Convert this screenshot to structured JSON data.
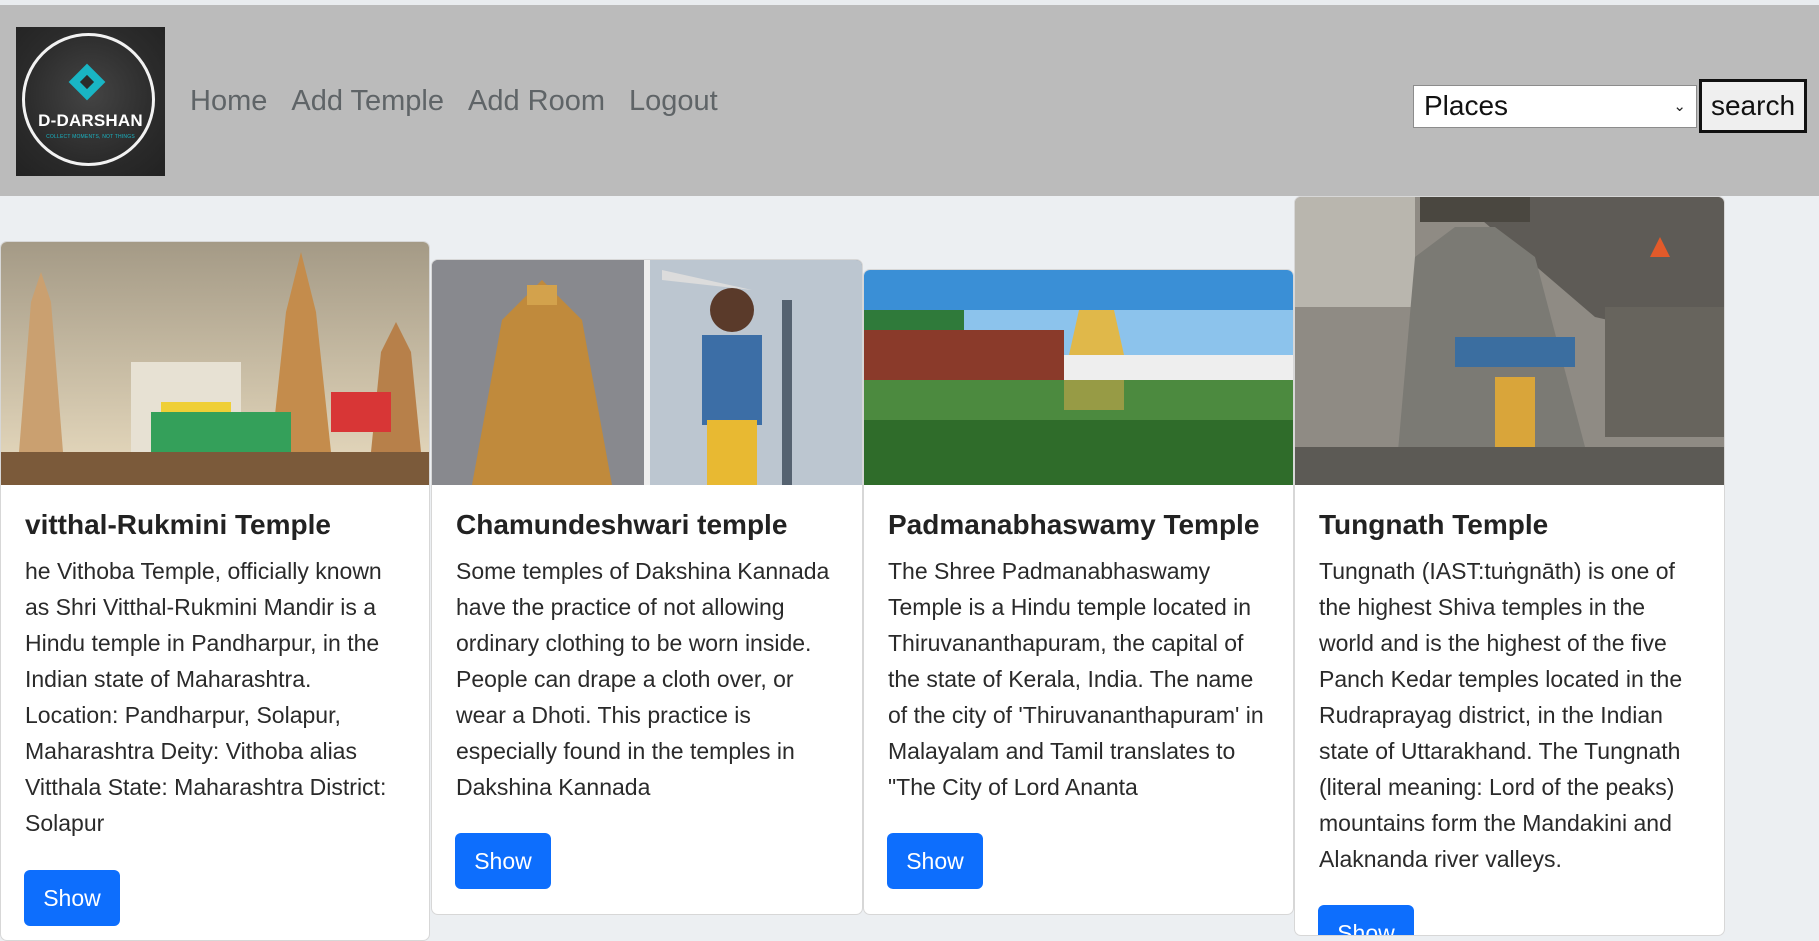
{
  "logo": {
    "title": "D-DARSHAN",
    "tagline": "COLLECT MOMENTS, NOT THINGS"
  },
  "nav": {
    "links": [
      "Home",
      "Add Temple",
      "Add Room",
      "Logout"
    ]
  },
  "search": {
    "selected": "Places",
    "button_label": "search"
  },
  "cards": [
    {
      "title": "vitthal-Rukmini Temple",
      "text": "he Vithoba Temple, officially known as Shri Vitthal-Rukmini Mandir is a Hindu temple in Pandharpur, in the Indian state of Maharashtra. Location: Pandharpur, Solapur, Maharashtra Deity: Vithoba alias Vitthala State: Maharashtra District: Solapur",
      "button": "Show",
      "image_icon": "temple-photo"
    },
    {
      "title": "Chamundeshwari temple",
      "text": "Some temples of Dakshina Kannada have the practice of not allowing ordinary clothing to be worn inside. People can drape a cloth over, or wear a Dhoti. This practice is especially found in the temples in Dakshina Kannada",
      "button": "Show",
      "image_icon": "temple-photo"
    },
    {
      "title": "Padmanabhaswamy Temple",
      "text": "The Shree Padmanabhaswamy Temple is a Hindu temple located in Thiruvananthapuram, the capital of the state of Kerala, India. The name of the city of 'Thiruvananthapuram' in Malayalam and Tamil translates to \"The City of Lord Ananta",
      "button": "Show",
      "image_icon": "temple-photo"
    },
    {
      "title": "Tungnath Temple",
      "text": "Tungnath (IAST:tuṅgnāth) is one of the highest Shiva temples in the world and is the highest of the five Panch Kedar temples located in the Rudraprayag district, in the Indian state of Uttarakhand. The Tungnath (literal meaning: Lord of the peaks) mountains form the Mandakini and Alaknanda river valleys.",
      "button": "Show",
      "image_icon": "temple-photo"
    }
  ]
}
